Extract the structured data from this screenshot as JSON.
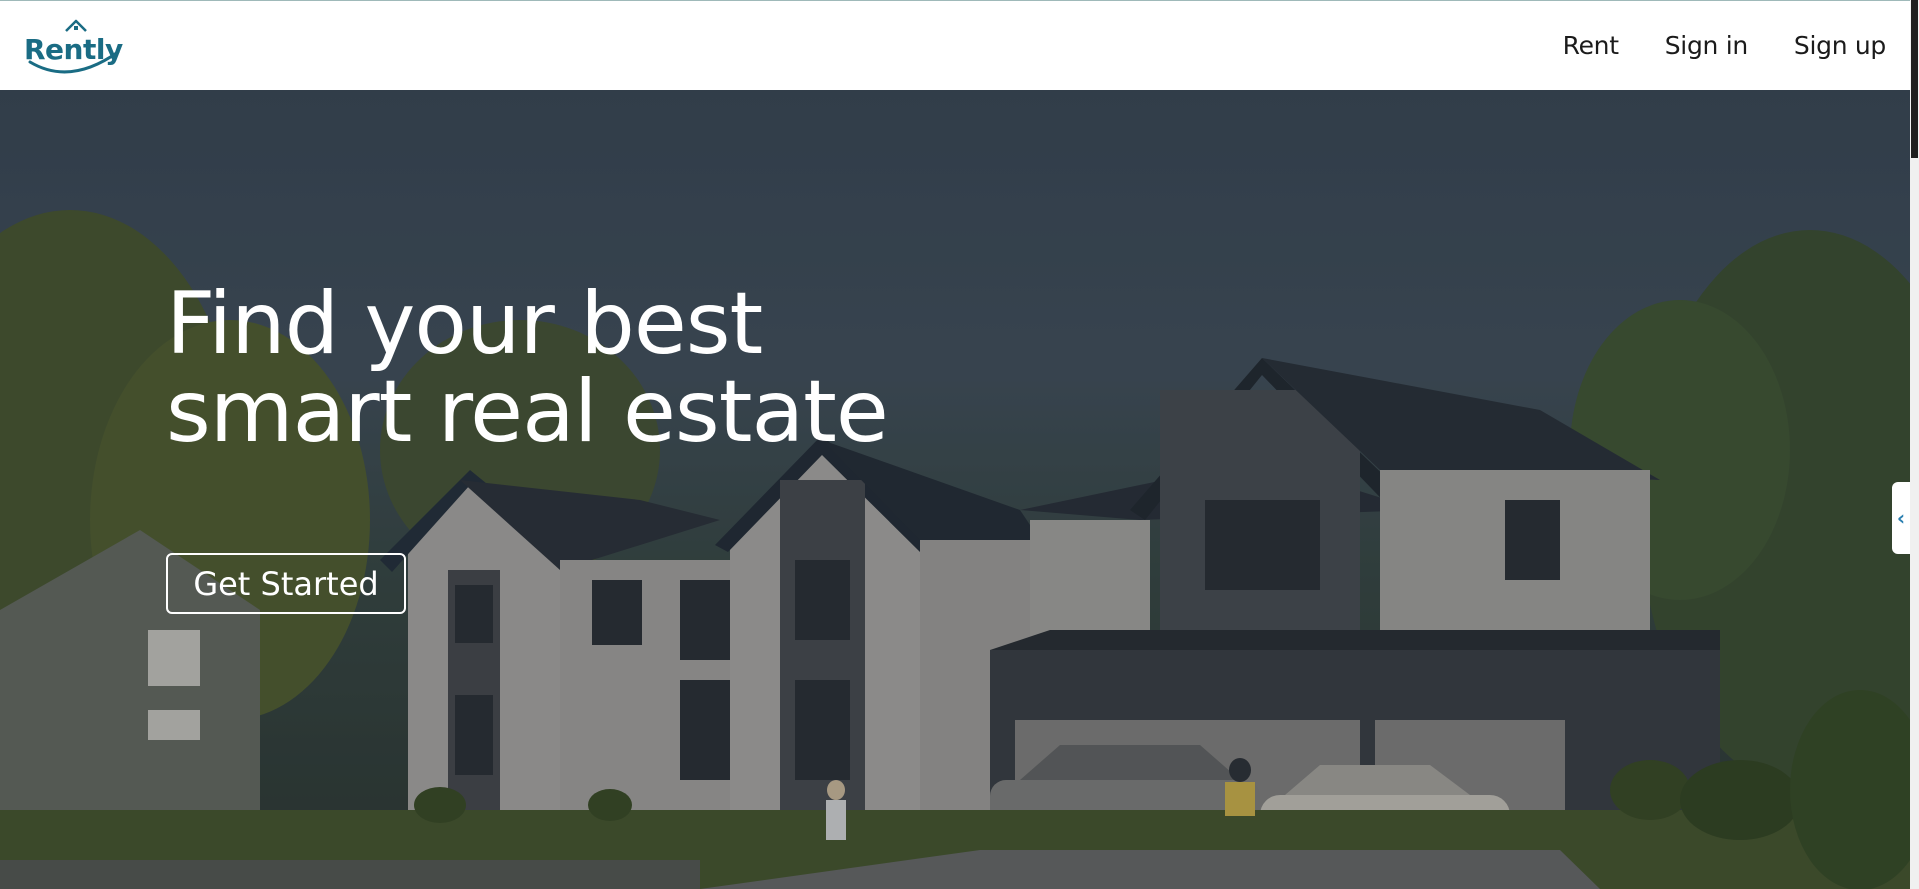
{
  "brand": {
    "name": "Rently"
  },
  "nav": {
    "rent": "Rent",
    "sign_in": "Sign in",
    "sign_up": "Sign up"
  },
  "hero": {
    "title_line1": "Find your best",
    "title_line2": "smart real estate",
    "cta_label": "Get Started"
  },
  "side_tab": {
    "icon": "chevron-left-icon",
    "glyph": "‹"
  },
  "colors": {
    "brand": "#1a6c84",
    "nav_text": "#1b1b1b",
    "hero_text": "#ffffff",
    "side_tab_icon": "#2a7fb0"
  }
}
